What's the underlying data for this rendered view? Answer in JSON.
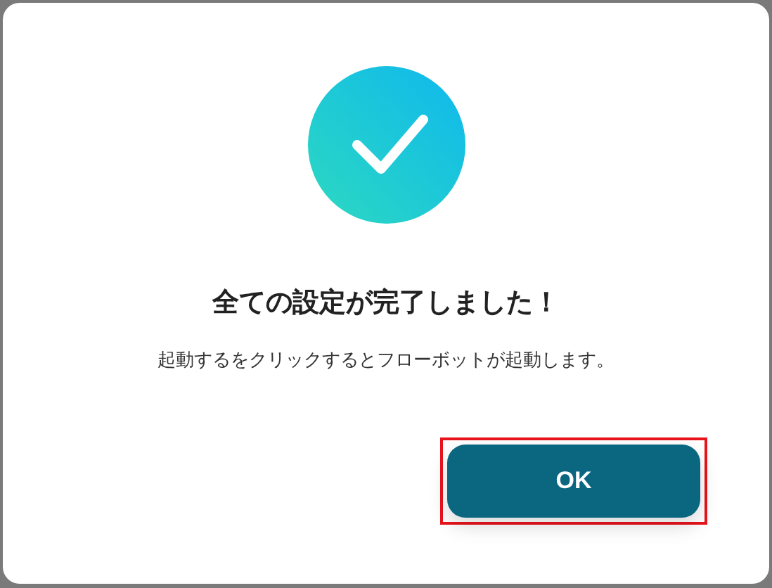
{
  "dialog": {
    "title": "全ての設定が完了しました！",
    "message": "起動するをクリックするとフローボットが起動します。",
    "buttons": [
      {
        "label": "OK",
        "highlighted": true
      }
    ]
  }
}
